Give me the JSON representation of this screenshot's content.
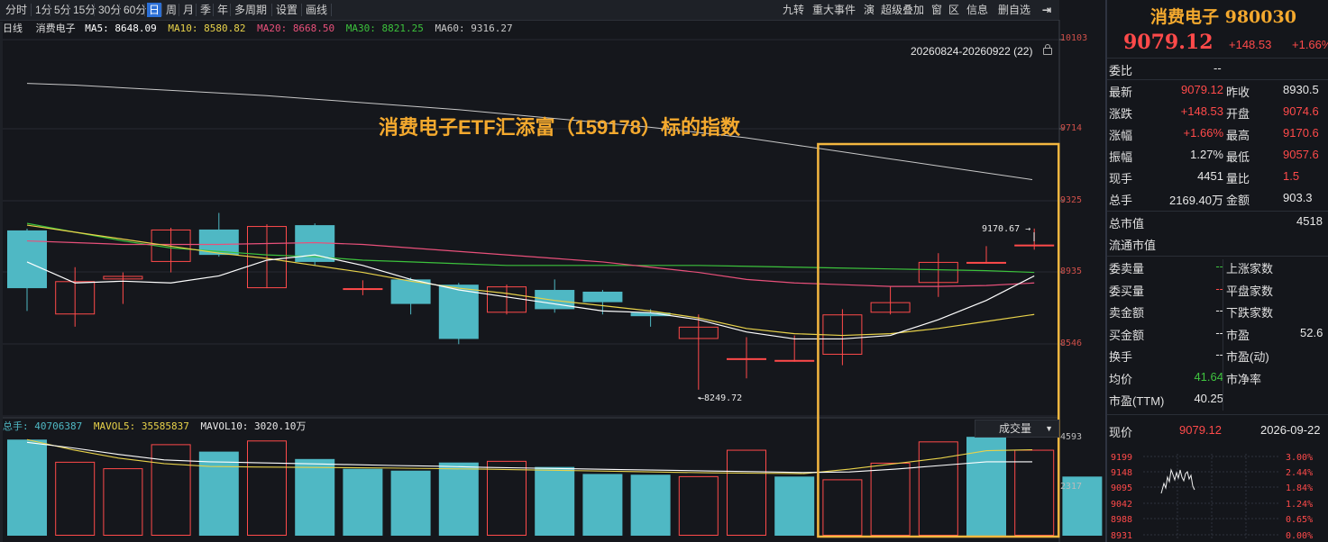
{
  "toolbar": {
    "periods": [
      "分时",
      "1分",
      "5分",
      "15分",
      "30分",
      "60分",
      "日",
      "周",
      "月",
      "季",
      "年",
      "多周期",
      "设置",
      "画线"
    ],
    "selected": "日",
    "right_items": [
      "九转",
      "重大事件",
      "演",
      "超级叠加",
      "窗",
      "区",
      "信息",
      "删自选"
    ],
    "exit_icon": "exit-icon"
  },
  "ma_bar": {
    "period": "日线",
    "name": "消费电子",
    "ma5": "MA5: 8648.09",
    "ma10": "MA10: 8580.82",
    "ma20": "MA20: 8668.50",
    "ma30": "MA30: 8821.25",
    "ma60": "MA60: 9316.27"
  },
  "range_label": "20260824-20260922 (22)",
  "annotation": "消费电子ETF汇添富（159178）标的指数",
  "price_axis": [
    "10103",
    "9714",
    "9325",
    "8935",
    "8546"
  ],
  "hi_label": "9170.67",
  "lo_label": "8249.72",
  "vol_bar": {
    "total": "总手: 40706387",
    "mavol5": "MAVOL5: 35585837",
    "mavol10": "MAVOL10: 3020.10万"
  },
  "vol_select": "成交量",
  "vol_axis": [
    "4593",
    "2317"
  ],
  "colors": {
    "up": "#ff4a4a",
    "down": "#4fb8c4",
    "ma5": "#ffffff",
    "ma10": "#e8d24a",
    "ma20": "#e8507a",
    "ma30": "#3cc23c",
    "ma60": "#c8c8c8",
    "highlight": "#f4b740"
  },
  "chart_data": {
    "type": "candlestick",
    "title": "消费电子ETF汇添富（159178）标的指数",
    "ylim": [
      8100,
      10250
    ],
    "candles": [
      {
        "o": 9160,
        "c": 8830,
        "h": 9170,
        "l": 8700
      },
      {
        "o": 8680,
        "c": 8870,
        "h": 8950,
        "l": 8610
      },
      {
        "o": 8880,
        "c": 8900,
        "h": 8920,
        "l": 8740
      },
      {
        "o": 8980,
        "c": 9165,
        "h": 9175,
        "l": 8920
      },
      {
        "o": 9165,
        "c": 9020,
        "h": 9260,
        "l": 9010
      },
      {
        "o": 8830,
        "c": 9185,
        "h": 9195,
        "l": 8830
      },
      {
        "o": 9190,
        "c": 8980,
        "h": 9200,
        "l": 8960
      },
      {
        "o": 8830,
        "c": 8830,
        "h": 8875,
        "l": 8790
      },
      {
        "o": 8880,
        "c": 8740,
        "h": 8890,
        "l": 8680
      },
      {
        "o": 8850,
        "c": 8540,
        "h": 8860,
        "l": 8510
      },
      {
        "o": 8690,
        "c": 8840,
        "h": 8850,
        "l": 8680
      },
      {
        "o": 8820,
        "c": 8710,
        "h": 8880,
        "l": 8690
      },
      {
        "o": 8810,
        "c": 8750,
        "h": 8820,
        "l": 8680
      },
      {
        "o": 8690,
        "c": 8670,
        "h": 8710,
        "l": 8610
      },
      {
        "o": 8540,
        "c": 8610,
        "h": 8680,
        "l": 8250
      },
      {
        "o": 8430,
        "c": 8430,
        "h": 8550,
        "l": 8315
      },
      {
        "o": 8420,
        "c": 8420,
        "h": 8560,
        "l": 8410
      },
      {
        "o": 8450,
        "c": 8680,
        "h": 8710,
        "l": 8390
      },
      {
        "o": 8690,
        "c": 8750,
        "h": 8840,
        "l": 8680
      },
      {
        "o": 8860,
        "c": 8980,
        "h": 9030,
        "l": 8780
      },
      {
        "o": 8980,
        "c": 8980,
        "h": 9070,
        "l": 8970
      },
      {
        "o": 9070,
        "c": 9079.12,
        "h": 9170.67,
        "l": 9050
      }
    ],
    "ma5": [
      8980,
      8860,
      8870,
      8860,
      8900,
      8990,
      9020,
      8960,
      8880,
      8820,
      8780,
      8740,
      8700,
      8690,
      8650,
      8580,
      8540,
      8540,
      8560,
      8650,
      8760,
      8900
    ],
    "ma10": [
      9190,
      9150,
      9110,
      9070,
      9030,
      9000,
      8960,
      8920,
      8870,
      8830,
      8800,
      8760,
      8730,
      8700,
      8660,
      8600,
      8570,
      8560,
      8570,
      8600,
      8640,
      8680
    ],
    "ma20": [
      9100,
      9090,
      9080,
      9080,
      9080,
      9085,
      9090,
      9080,
      9060,
      9040,
      9020,
      9000,
      8980,
      8950,
      8920,
      8880,
      8860,
      8850,
      8840,
      8840,
      8845,
      8860
    ],
    "ma30": [
      9200,
      9150,
      9100,
      9060,
      9040,
      9020,
      9010,
      8990,
      8980,
      8970,
      8960,
      8960,
      8960,
      8960,
      8960,
      8955,
      8950,
      8945,
      8940,
      8935,
      8930,
      8920
    ],
    "ma60": [
      10000,
      9990,
      9975,
      9960,
      9945,
      9930,
      9910,
      9890,
      9870,
      9850,
      9825,
      9800,
      9775,
      9750,
      9720,
      9690,
      9650,
      9610,
      9570,
      9530,
      9490,
      9450
    ],
    "volume": [
      5200,
      4000,
      3650,
      4950,
      4550,
      5150,
      4150,
      3620,
      3520,
      3960,
      4050,
      3720,
      3340,
      3300,
      3220,
      4650,
      3200,
      3050,
      3950,
      5100,
      5350,
      4650,
      3200
    ],
    "volume_up": [
      false,
      true,
      true,
      true,
      false,
      true,
      false,
      false,
      false,
      false,
      true,
      false,
      false,
      false,
      true,
      true,
      false,
      true,
      true,
      true,
      false,
      true
    ],
    "mavol5": [
      5200,
      4650,
      4200,
      3900,
      3750,
      3720,
      3700,
      3680,
      3660,
      3630,
      3600,
      3560,
      3520,
      3480,
      3440,
      3400,
      3380,
      3360,
      3600,
      3900,
      4200,
      4600,
      4650
    ],
    "mavol10": [
      5050,
      4750,
      4400,
      4100,
      4000,
      3950,
      3900,
      3850,
      3800,
      3760,
      3700,
      3660,
      3620,
      3580,
      3540,
      3500,
      3460,
      3420,
      3450,
      3600,
      3800,
      4000,
      4000
    ],
    "highlight_range": [
      17,
      21
    ]
  },
  "panel": {
    "name": "消费电子 980030",
    "price": "9079.12",
    "change": "+148.53",
    "change_pct": "+1.66%",
    "rows_a": [
      {
        "l": "委比",
        "v": "--",
        "c": "wht"
      }
    ],
    "rows_b": [
      {
        "l1": "最新",
        "v1": "9079.12",
        "c1": "red",
        "l2": "昨收",
        "v2": "8930.5",
        "c2": "wht"
      },
      {
        "l1": "涨跌",
        "v1": "+148.53",
        "c1": "red",
        "l2": "开盘",
        "v2": "9074.6",
        "c2": "red"
      },
      {
        "l1": "涨幅",
        "v1": "+1.66%",
        "c1": "red",
        "l2": "最高",
        "v2": "9170.6",
        "c2": "red"
      },
      {
        "l1": "振幅",
        "v1": "1.27%",
        "c1": "wht",
        "l2": "最低",
        "v2": "9057.6",
        "c2": "red"
      },
      {
        "l1": "现手",
        "v1": "4451",
        "c1": "wht",
        "l2": "量比",
        "v2": "1.5",
        "c2": "red"
      },
      {
        "l1": "总手",
        "v1": "2169.40万",
        "c1": "wht",
        "l2": "金额",
        "v2": "903.3",
        "c2": "wht"
      }
    ],
    "rows_c": [
      {
        "l1": "总市值",
        "v1": "",
        "c1": "wht",
        "l2": "",
        "v2": "4518",
        "c2": "wht"
      },
      {
        "l1": "流通市值",
        "v1": "",
        "c1": "wht",
        "l2": "",
        "v2": "",
        "c2": "wht"
      }
    ],
    "rows_d": [
      {
        "l1": "委卖量",
        "v1": "--",
        "c1": "grn",
        "l2": "上涨家数",
        "v2": "",
        "c2": "wht"
      },
      {
        "l1": "委买量",
        "v1": "--",
        "c1": "red",
        "l2": "平盘家数",
        "v2": "",
        "c2": "wht"
      },
      {
        "l1": "卖金额",
        "v1": "--",
        "c1": "wht",
        "l2": "下跌家数",
        "v2": "",
        "c2": "wht"
      },
      {
        "l1": "买金额",
        "v1": "--",
        "c1": "wht",
        "l2": "市盈",
        "v2": "52.6",
        "c2": "wht"
      },
      {
        "l1": "换手",
        "v1": "--",
        "c1": "wht",
        "l2": "市盈(动)",
        "v2": "",
        "c2": "wht"
      },
      {
        "l1": "均价",
        "v1": "41.64",
        "c1": "grn",
        "l2": "市净率",
        "v2": "",
        "c2": "wht"
      },
      {
        "l1": "市盈(TTM)",
        "v1": "40.25",
        "c1": "wht",
        "l2": "",
        "v2": "",
        "c2": "wht"
      }
    ],
    "now_label": "现价",
    "now_value": "9079.12",
    "date": "2026-09-22",
    "mini_left": [
      "9199",
      "9148",
      "9095",
      "9042",
      "8988",
      "8931"
    ],
    "mini_right": [
      "3.00%",
      "2.44%",
      "1.84%",
      "1.24%",
      "0.65%",
      "0.00%"
    ]
  }
}
